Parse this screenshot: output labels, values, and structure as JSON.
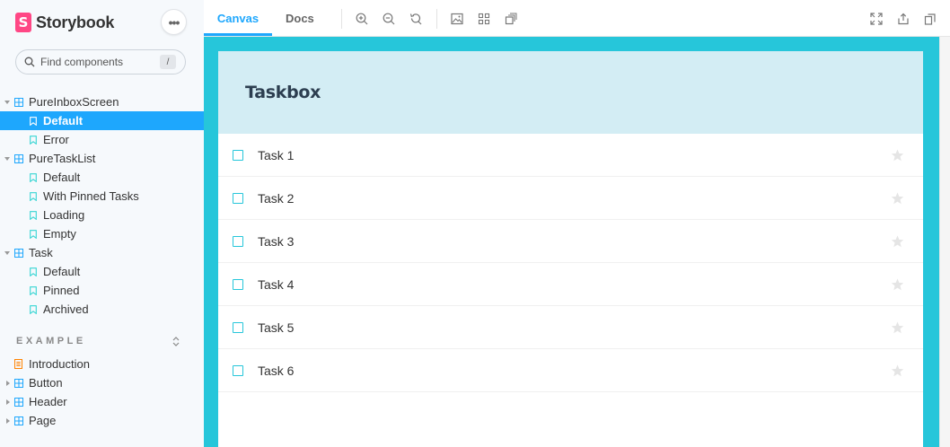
{
  "sidebar": {
    "brand": "Storybook",
    "logo_letter": "S",
    "more": "•••",
    "search": {
      "placeholder": "Find components",
      "shortcut": "/"
    },
    "tree": [
      {
        "label": "PureInboxScreen",
        "type": "component",
        "expanded": true
      },
      {
        "label": "Default",
        "type": "story",
        "selected": true
      },
      {
        "label": "Error",
        "type": "story"
      },
      {
        "label": "PureTaskList",
        "type": "component",
        "expanded": true
      },
      {
        "label": "Default",
        "type": "story"
      },
      {
        "label": "With Pinned Tasks",
        "type": "story"
      },
      {
        "label": "Loading",
        "type": "story"
      },
      {
        "label": "Empty",
        "type": "story"
      },
      {
        "label": "Task",
        "type": "component",
        "expanded": true
      },
      {
        "label": "Default",
        "type": "story"
      },
      {
        "label": "Pinned",
        "type": "story"
      },
      {
        "label": "Archived",
        "type": "story"
      }
    ],
    "section": "EXAMPLE",
    "section_tree": [
      {
        "label": "Introduction",
        "type": "doc"
      },
      {
        "label": "Button",
        "type": "component",
        "expanded": false
      },
      {
        "label": "Header",
        "type": "component",
        "expanded": false
      },
      {
        "label": "Page",
        "type": "component",
        "expanded": false
      }
    ]
  },
  "toolbar": {
    "tabs": [
      {
        "label": "Canvas",
        "active": true
      },
      {
        "label": "Docs",
        "active": false
      }
    ],
    "icons": [
      "zoom-in-icon",
      "zoom-out-icon",
      "zoom-reset-icon",
      "background-icon",
      "grid-icon",
      "outline-icon",
      "fullscreen-icon",
      "share-icon",
      "copy-link-icon"
    ]
  },
  "preview": {
    "title": "Taskbox",
    "tasks": [
      {
        "title": "Task 1"
      },
      {
        "title": "Task 2"
      },
      {
        "title": "Task 3"
      },
      {
        "title": "Task 4"
      },
      {
        "title": "Task 5"
      },
      {
        "title": "Task 6"
      }
    ]
  },
  "colors": {
    "accent": "#1ea7fd",
    "canvas": "#26c6da",
    "header_bg": "#d3edf4",
    "logo": "#ff4785"
  }
}
